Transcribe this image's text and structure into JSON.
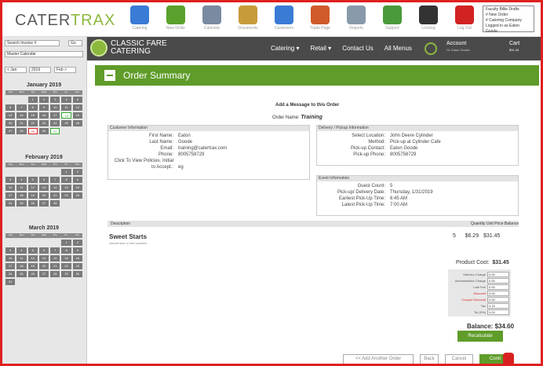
{
  "app": {
    "logo_a": "CATER",
    "logo_b": "TRAX"
  },
  "top_icons": [
    {
      "icon": "catering-icon",
      "label": "Catering"
    },
    {
      "icon": "new-order-icon",
      "label": "New Order"
    },
    {
      "icon": "calendar-icon",
      "label": "Calendar"
    },
    {
      "icon": "documents-icon",
      "label": "Documents"
    },
    {
      "icon": "customers-icon",
      "label": "Customers"
    },
    {
      "icon": "trade-page-icon",
      "label": "Trade Page"
    },
    {
      "icon": "reports-icon",
      "label": "Reports"
    },
    {
      "icon": "support-icon",
      "label": "Support"
    },
    {
      "icon": "locking-icon",
      "label": "Locking"
    },
    {
      "icon": "logout-icon",
      "label": "Log Out"
    }
  ],
  "status_box": {
    "line1": "Faculty Billie Drafts",
    "line2": "# New Order",
    "line3": "# Catering Company",
    "line4": "Logged in as Eaton Goode"
  },
  "sidebar": {
    "search_label": "Search Invoice #",
    "go": "Go",
    "view": "Master Calendar",
    "nav_prev": "< Jan",
    "nav_year": "2019",
    "nav_next": "Feb >",
    "calendars": [
      {
        "title": "January 2019",
        "head": "Sun Mon Tue Wed Thu Fri Sat",
        "days": [
          "",
          "",
          "1",
          "2",
          "3",
          "4",
          "5",
          "6",
          "7",
          "8",
          "9",
          "10",
          "11",
          "12",
          "13",
          "14",
          "15",
          "16",
          "17",
          "18",
          "19",
          "20",
          "21",
          "22",
          "23",
          "24",
          "25",
          "26",
          "27",
          "28",
          "29",
          "30",
          "31",
          "",
          ""
        ]
      },
      {
        "title": "February 2019",
        "head": "Sun Mon Tue Wed Thu Fri Sat",
        "days": [
          "",
          "",
          "",
          "",
          "",
          "1",
          "2",
          "3",
          "4",
          "5",
          "6",
          "7",
          "8",
          "9",
          "10",
          "11",
          "12",
          "13",
          "14",
          "15",
          "16",
          "17",
          "18",
          "19",
          "20",
          "21",
          "22",
          "23",
          "24",
          "25",
          "26",
          "27",
          "28",
          "",
          ""
        ]
      },
      {
        "title": "March 2019",
        "head": "Sun Mon Tue Wed Thu Fri Sat",
        "days": [
          "",
          "",
          "",
          "",
          "",
          "1",
          "2",
          "3",
          "4",
          "5",
          "6",
          "7",
          "8",
          "9",
          "10",
          "11",
          "12",
          "13",
          "14",
          "15",
          "16",
          "17",
          "18",
          "19",
          "20",
          "21",
          "22",
          "23",
          "24",
          "25",
          "26",
          "27",
          "28",
          "29",
          "30",
          "31",
          "",
          "",
          "",
          "",
          "",
          ""
        ]
      }
    ]
  },
  "nav": {
    "brand1": "CLASSIC FARE",
    "brand2": "CATERING",
    "items": [
      "Catering ▾",
      "Retail ▾",
      "Contact Us",
      "All Menus"
    ],
    "account": "Account",
    "account_sub": "Hi, Eaton Goode",
    "cart": "Cart",
    "cart_sub": "$31.45"
  },
  "title": "Order Summary",
  "message_link": "Add a Message to this Order",
  "order_name_label": "Order Name:",
  "order_name": "Training",
  "customer": {
    "header": "Customer Information",
    "rows": [
      {
        "k": "First Name:",
        "v": "Eaton"
      },
      {
        "k": "Last Name:",
        "v": "Goode"
      },
      {
        "k": "Email:",
        "v": "training@catertrax.com"
      },
      {
        "k": "Phone:",
        "v": "8005758729"
      },
      {
        "k": "Click To View Policies. Initial to Accept.:",
        "v": "eg"
      }
    ]
  },
  "delivery": {
    "header": "Delivery / Pickup Information",
    "rows": [
      {
        "k": "Select Location:",
        "v": "John Deere Cylinder"
      },
      {
        "k": "Method:",
        "v": "Pick-up at Cylinder Cafe"
      },
      {
        "k": "Pick-up Contact:",
        "v": "Eaton Goode"
      },
      {
        "k": "Pick-up Phone:",
        "v": "8005758729"
      }
    ]
  },
  "event": {
    "header": "Event Information",
    "rows": [
      {
        "k": "Guest Count:",
        "v": "5"
      },
      {
        "k": "Pick-up/ Delivery Date:",
        "v": "Thursday, 1/31/2019"
      },
      {
        "k": "Earliest Pick-Up Time:",
        "v": "6:45 AM"
      },
      {
        "k": "Latest Pick-Up Time:",
        "v": "7:00 AM"
      }
    ]
  },
  "items_table": {
    "desc": "Description",
    "cols": "Quantity  Unit Price  Balance",
    "item_name": "Sweet Starts",
    "item_sub": "Assortment of mini pastries",
    "qty": "5",
    "unit": "$6.29",
    "bal": "$31.45"
  },
  "totals": {
    "product_cost_label": "Product Cost:",
    "product_cost": "$31.45",
    "fees": [
      {
        "k": "Delivery Charge",
        "v": "0.00",
        "red": false
      },
      {
        "k": "Administrative Charge",
        "v": "0.00",
        "red": false
      },
      {
        "k": "Late Fee",
        "v": "0.00",
        "red": false
      },
      {
        "k": "Discount",
        "v": "0.00",
        "red": true
      },
      {
        "k": "Coupon Discount",
        "v": "0.00",
        "red": true
      },
      {
        "k": "Tax",
        "v": "3.15",
        "red": false
      },
      {
        "k": "Tip (0%)",
        "v": "0.00",
        "red": false
      }
    ],
    "balance_label": "Balance:",
    "balance": "$34.60",
    "recalc": "Recalculate"
  },
  "buttons": {
    "add_another": "<< Add Another Order",
    "back": "Back",
    "cancel": "Cancel",
    "continue": "Conti"
  }
}
